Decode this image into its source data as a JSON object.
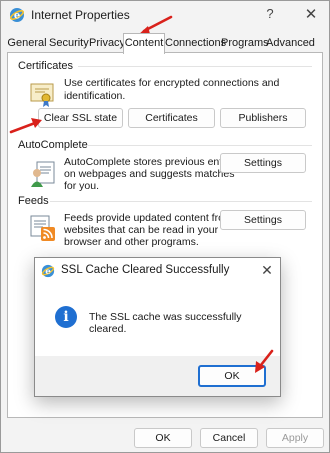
{
  "window": {
    "title": "Internet Properties",
    "help_glyph": "?",
    "close_glyph": "✕"
  },
  "tabs": [
    {
      "label": "General",
      "active": false
    },
    {
      "label": "Security",
      "active": false
    },
    {
      "label": "Privacy",
      "active": false
    },
    {
      "label": "Content",
      "active": true
    },
    {
      "label": "Connections",
      "active": false
    },
    {
      "label": "Programs",
      "active": false
    },
    {
      "label": "Advanced",
      "active": false
    }
  ],
  "certificates": {
    "heading": "Certificates",
    "description": "Use certificates for encrypted connections and identification.",
    "clear_ssl_label": "Clear SSL state",
    "certificates_label": "Certificates",
    "publishers_label": "Publishers"
  },
  "autocomplete": {
    "heading": "AutoComplete",
    "description_lines": [
      "AutoComplete stores previous entries",
      "on webpages and suggests matches",
      "for you."
    ],
    "settings_label": "Settings"
  },
  "feeds": {
    "heading": "Feeds",
    "description_lines": [
      "Feeds provide updated content from",
      "websites that can be read in your",
      "browser and other programs."
    ],
    "settings_label": "Settings"
  },
  "dialog": {
    "title": "SSL Cache Cleared Successfully",
    "message": "The SSL cache was successfully cleared.",
    "info_glyph": "i",
    "ok_label": "OK",
    "close_glyph": "✕"
  },
  "footer": {
    "ok_label": "OK",
    "cancel_label": "Cancel",
    "apply_label": "Apply"
  },
  "colors": {
    "annotation_arrow": "#d9211b",
    "accent": "#1f6fd1"
  }
}
